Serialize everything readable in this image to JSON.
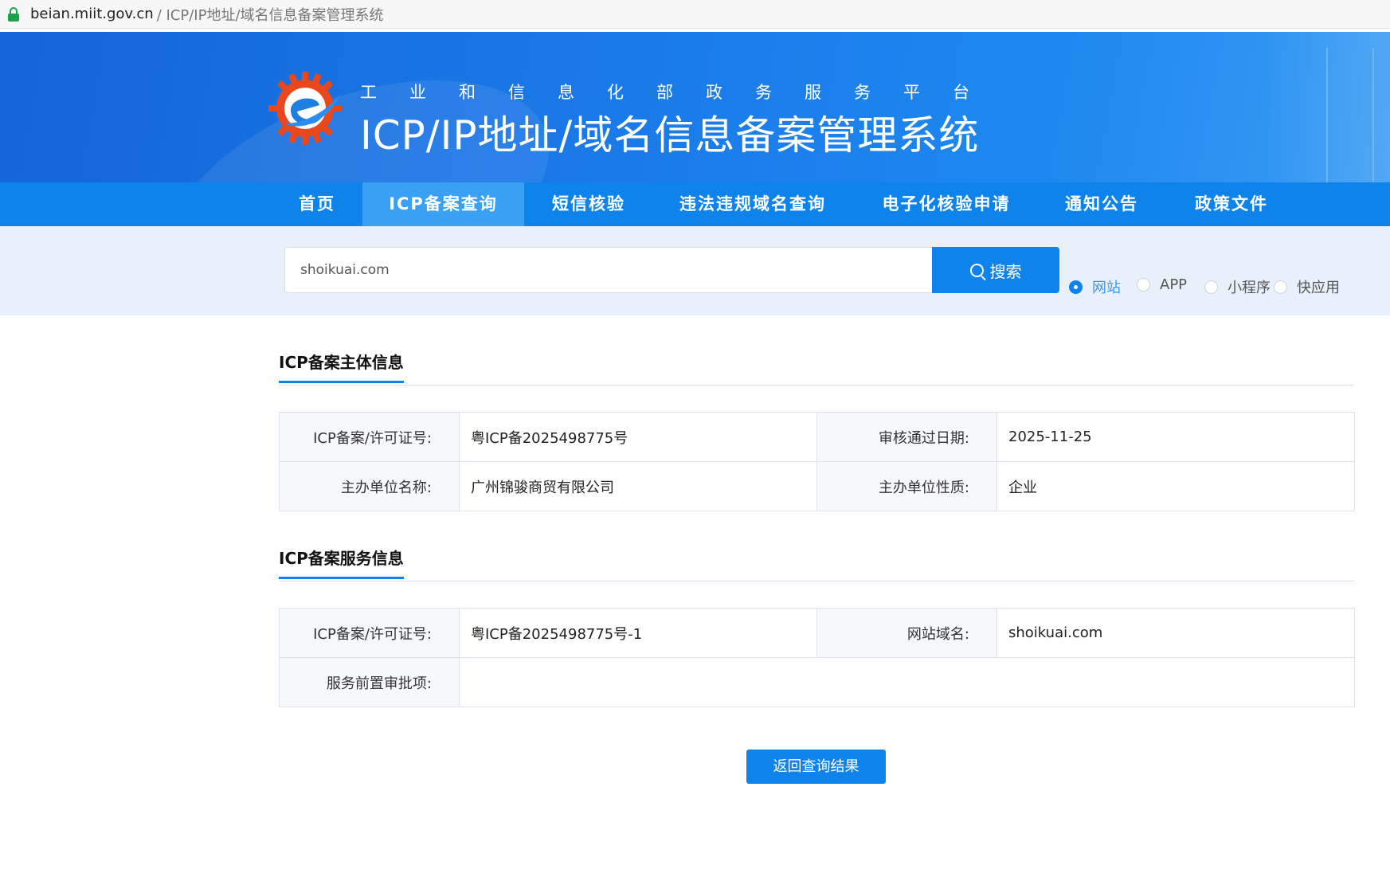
{
  "browser": {
    "host": "beian.miit.gov.cn",
    "path": "/ ICP/IP地址/域名信息备案管理系统"
  },
  "header": {
    "platform_name": "工业和信息化部政务服务平台",
    "system_title": "ICP/IP地址/域名信息备案管理系统"
  },
  "nav": {
    "items": [
      {
        "label": "首页"
      },
      {
        "label": "ICP备案查询",
        "active": true
      },
      {
        "label": "短信核验"
      },
      {
        "label": "违法违规域名查询"
      },
      {
        "label": "电子化核验申请"
      },
      {
        "label": "通知公告"
      },
      {
        "label": "政策文件"
      }
    ]
  },
  "search": {
    "value": "shoikuai.com",
    "button_label": "搜索",
    "types": [
      {
        "label": "网站",
        "selected": true
      },
      {
        "label": "APP",
        "selected": false
      },
      {
        "label": "小程序",
        "selected": false
      },
      {
        "label": "快应用",
        "selected": false
      }
    ]
  },
  "subject_info": {
    "title": "ICP备案主体信息",
    "rows": [
      {
        "label1": "ICP备案/许可证号:",
        "value1": "粤ICP备2025498775号",
        "label2": "审核通过日期:",
        "value2": "2025-11-25"
      },
      {
        "label1": "主办单位名称:",
        "value1": "广州锦骏商贸有限公司",
        "label2": "主办单位性质:",
        "value2": "企业"
      }
    ]
  },
  "service_info": {
    "title": "ICP备案服务信息",
    "license_label": "ICP备案/许可证号:",
    "license_value": "粤ICP备2025498775号-1",
    "domain_label": "网站域名:",
    "domain_value": "shoikuai.com",
    "approval_label": "服务前置审批项:",
    "approval_value": ""
  },
  "back_button_label": "返回查询结果",
  "colors": {
    "primary": "#0e83ec",
    "nav_active": "#3aa0f3",
    "search_bg": "#e8f1fa"
  }
}
